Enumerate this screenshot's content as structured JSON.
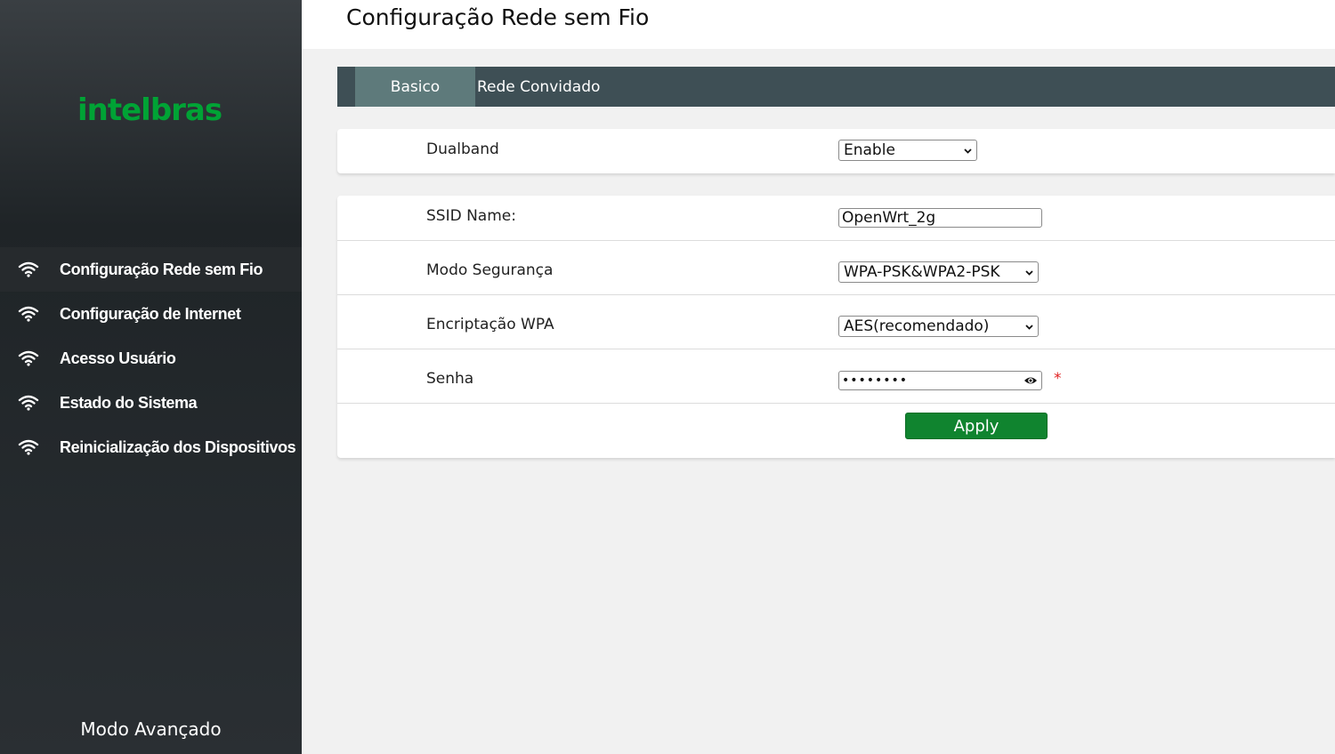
{
  "brand": {
    "logo_text": "intelbras",
    "accent_color": "#00a335"
  },
  "header": {
    "title": "Configuração Rede sem Fio"
  },
  "sidebar": {
    "items": [
      {
        "label": "Configuração Rede sem Fio",
        "icon": "wifi-icon",
        "active": true
      },
      {
        "label": "Configuração de Internet",
        "icon": "wifi-icon",
        "active": false
      },
      {
        "label": "Acesso Usuário",
        "icon": "wifi-icon",
        "active": false
      },
      {
        "label": "Estado do Sistema",
        "icon": "wifi-icon",
        "active": false
      },
      {
        "label": "Reinicialização dos Dispositivos",
        "icon": "wifi-icon",
        "active": false
      }
    ],
    "advanced_mode_label": "Modo Avançado"
  },
  "tabs": [
    {
      "label": "Basico",
      "active": true
    },
    {
      "label": "Rede Convidado",
      "active": false
    }
  ],
  "form": {
    "dualband": {
      "label": "Dualband",
      "value": "Enable"
    },
    "ssid": {
      "label": "SSID Name:",
      "value": "OpenWrt_2g"
    },
    "security_mode": {
      "label": "Modo Segurança",
      "value": "WPA-PSK&WPA2-PSK"
    },
    "wpa_encryption": {
      "label": "Encriptação WPA",
      "value": "AES(recomendado)"
    },
    "password": {
      "label": "Senha",
      "masked_value": "••••••••",
      "required_mark": "*"
    },
    "apply_label": "Apply"
  },
  "colors": {
    "tabbar": "#3e4f55",
    "tab_active": "#5e7a7b",
    "apply_button": "#10842f",
    "required": "#e02020"
  }
}
